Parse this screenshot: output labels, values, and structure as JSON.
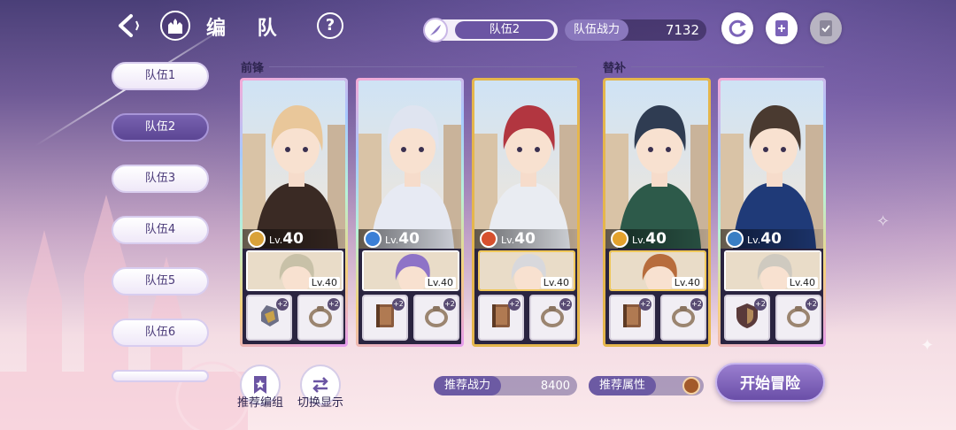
{
  "header": {
    "title": "编 队",
    "current_team": "队伍2",
    "power_label": "队伍战力",
    "power_value": "7132"
  },
  "icons": {
    "back": "back-arrow-icon",
    "home": "castle-icon",
    "help": "?",
    "refresh": "refresh-icon",
    "add": "add-document-icon",
    "confirm": "check-document-icon"
  },
  "teams": [
    {
      "label": "队伍1"
    },
    {
      "label": "队伍2",
      "active": true
    },
    {
      "label": "队伍3"
    },
    {
      "label": "队伍4"
    },
    {
      "label": "队伍5"
    },
    {
      "label": "队伍6"
    }
  ],
  "sections": {
    "front": "前锋",
    "sub": "替补"
  },
  "cards": [
    {
      "level_prefix": "Lv.",
      "level": "40",
      "support_level": "Lv.40",
      "element_color": "#d9a23a",
      "frame": "rainbow",
      "hair": "#e9c79a",
      "outfit": "#3a2a24",
      "support_hair": "#c8c1a8",
      "equip": [
        "gauntlet-icon",
        "ring-icon"
      ],
      "badge": "+2"
    },
    {
      "level_prefix": "Lv.",
      "level": "40",
      "support_level": "Lv.40",
      "element_color": "#3b7fd6",
      "frame": "rainbow",
      "hair": "#dfe4f0",
      "outfit": "#e7eaf3",
      "support_hair": "#8e73c7",
      "equip": [
        "book-icon",
        "ring-icon"
      ],
      "badge": "+2"
    },
    {
      "level_prefix": "Lv.",
      "level": "40",
      "support_level": "Lv.40",
      "element_color": "#d6502e",
      "frame": "gold",
      "hair": "#b23640",
      "outfit": "#e9ecf2",
      "support_hair": "#d8d8dc",
      "equip": [
        "book-icon",
        "ring-icon"
      ],
      "badge": "+2"
    },
    {
      "level_prefix": "Lv.",
      "level": "40",
      "support_level": "Lv.40",
      "element_color": "#e3a22d",
      "frame": "gold",
      "hair": "#2f3c52",
      "outfit": "#2d5a4a",
      "support_hair": "#b76c3c",
      "equip": [
        "book-icon",
        "ring-icon"
      ],
      "badge": "+2"
    },
    {
      "level_prefix": "Lv.",
      "level": "40",
      "support_level": "Lv.40",
      "element_color": "#3a7fc4",
      "frame": "rainbow",
      "hair": "#4a3a30",
      "outfit": "#1f3a78",
      "support_hair": "#cfcac0",
      "equip": [
        "shield-icon",
        "ring-icon"
      ],
      "badge": "+2"
    }
  ],
  "bottom": {
    "recommend_team": "推荐编组",
    "switch_display": "切换显示",
    "rec_power_label": "推荐战力",
    "rec_power_value": "8400",
    "rec_attr_label": "推荐属性",
    "start": "开始冒险"
  }
}
